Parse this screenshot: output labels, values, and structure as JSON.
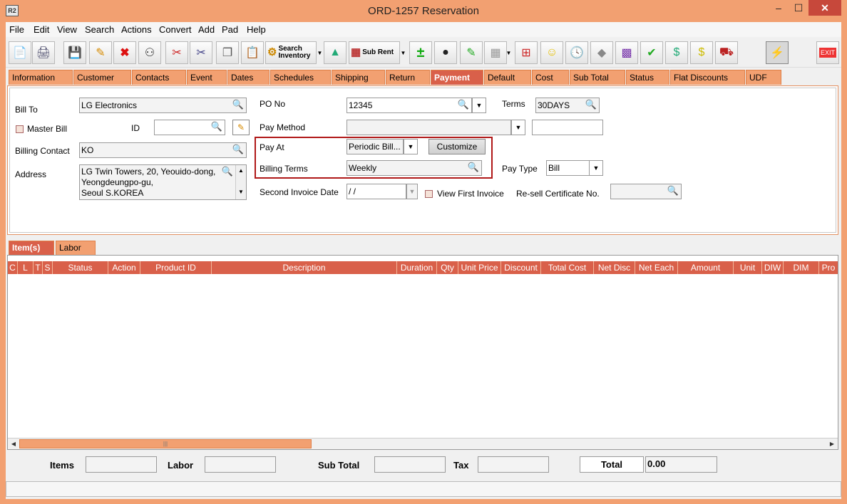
{
  "window": {
    "title": "ORD-1257 Reservation",
    "app_icon": "R2",
    "minimize": "–",
    "maximize": "☐",
    "close": "✕"
  },
  "menu": [
    "File",
    "Edit",
    "View",
    "Search",
    "Actions",
    "Convert",
    "Add",
    "Pad",
    "Help"
  ],
  "toolbar": {
    "search_inventory": "Search Inventory",
    "sub_rent": "Sub Rent",
    "exit": "EXIT"
  },
  "tabs": [
    "Information",
    "Customer",
    "Contacts",
    "Event",
    "Dates",
    "Schedules",
    "Shipping",
    "Return",
    "Payment",
    "Default",
    "Cost",
    "Sub Total",
    "Status",
    "Flat Discounts",
    "UDF"
  ],
  "active_tab": "Payment",
  "form": {
    "bill_to_label": "Bill To",
    "bill_to_value": "LG Electronics",
    "master_bill_label": "Master Bill",
    "id_label": "ID",
    "id_value": "",
    "billing_contact_label": "Billing Contact",
    "billing_contact_value": "KO",
    "address_label": "Address",
    "address_lines": [
      "LG Twin Towers, 20, Yeouido-dong,",
      "Yeongdeungpo-gu,",
      "Seoul S.KOREA"
    ],
    "po_no_label": "PO No",
    "po_no_value": "12345",
    "terms_label": "Terms",
    "terms_value": "30DAYS",
    "pay_method_label": "Pay Method",
    "pay_method_value": "",
    "pay_method_extra": "",
    "pay_at_label": "Pay At",
    "pay_at_value": "Periodic Bill...",
    "customize_label": "Customize",
    "billing_terms_label": "Billing Terms",
    "billing_terms_value": "Weekly",
    "pay_type_label": "Pay Type",
    "pay_type_value": "Bill",
    "second_invoice_label": "Second Invoice Date",
    "second_invoice_value": " / /",
    "view_first_invoice_label": "View First Invoice",
    "resell_label": "Re-sell Certificate No.",
    "resell_value": ""
  },
  "subtabs": [
    "Item(s)",
    "Labor"
  ],
  "grid_columns": [
    "C",
    "L",
    "T",
    "S",
    "Status",
    "Action",
    "Product ID",
    "Description",
    "Duration",
    "Qty",
    "Unit Price",
    "Discount",
    "Total Cost",
    "Net Disc",
    "Net Each",
    "Amount",
    "Unit",
    "DIW",
    "DIM",
    "Pro"
  ],
  "totals": {
    "items_label": "Items",
    "items_value": "",
    "labor_label": "Labor",
    "labor_value": "",
    "subtotal_label": "Sub Total",
    "subtotal_value": "",
    "tax_label": "Tax",
    "tax_value": "",
    "total_label": "Total",
    "total_value": "0.00"
  },
  "colors": {
    "accent": "#f2a071",
    "active_tab": "#d9604a",
    "highlight": "#b01818"
  }
}
